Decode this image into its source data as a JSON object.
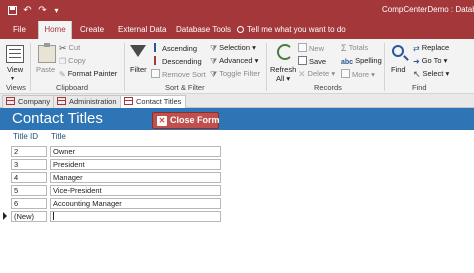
{
  "app_title": "CompCenterDemo : Database-",
  "quick_access": {
    "undo_icon": "undo-icon",
    "redo_icon": "redo-icon",
    "save_icon": "save-icon"
  },
  "ribbon_tabs": [
    {
      "label": "File"
    },
    {
      "label": "Home",
      "active": true
    },
    {
      "label": "Create"
    },
    {
      "label": "External Data"
    },
    {
      "label": "Database Tools"
    }
  ],
  "tell_me": "Tell me what you want to do",
  "ribbon": {
    "views": {
      "label": "Views",
      "view": "View"
    },
    "clipboard": {
      "label": "Clipboard",
      "paste": "Paste",
      "cut": "Cut",
      "copy": "Copy",
      "format_painter": "Format Painter"
    },
    "sort_filter": {
      "label": "Sort & Filter",
      "filter": "Filter",
      "ascending": "Ascending",
      "descending": "Descending",
      "remove_sort": "Remove Sort",
      "selection": "Selection",
      "advanced": "Advanced",
      "toggle_filter": "Toggle Filter"
    },
    "records": {
      "label": "Records",
      "refresh": "Refresh",
      "refresh_2": "All",
      "new": "New",
      "save": "Save",
      "delete": "Delete",
      "totals": "Totals",
      "spelling": "Spelling",
      "more": "More"
    },
    "find": {
      "label": "Find",
      "find": "Find",
      "replace": "Replace",
      "go_to": "Go To",
      "select": "Select"
    }
  },
  "document_tabs": [
    {
      "label": "Company"
    },
    {
      "label": "Administration"
    },
    {
      "label": "Contact Titles",
      "active": true
    }
  ],
  "form": {
    "title": "Contact Titles",
    "close_button": "Close Form",
    "columns": {
      "id": "Title ID",
      "title": "Title"
    },
    "rows": [
      {
        "id": "2",
        "title": "Owner"
      },
      {
        "id": "3",
        "title": "President"
      },
      {
        "id": "4",
        "title": "Manager"
      },
      {
        "id": "5",
        "title": "Vice-President"
      },
      {
        "id": "6",
        "title": "Accounting Manager"
      }
    ],
    "new_row": {
      "id": "(New)",
      "title": ""
    }
  },
  "colors": {
    "access_red": "#a4373a",
    "form_header_blue": "#2e75b6",
    "close_button_red": "#c0504d"
  }
}
